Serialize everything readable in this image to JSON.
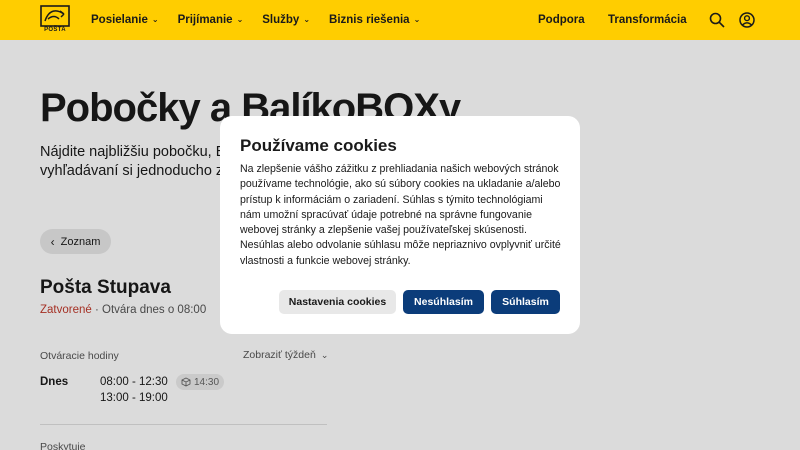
{
  "header": {
    "logo_text": "POŠTA",
    "nav": [
      {
        "label": "Posielanie"
      },
      {
        "label": "Prijímanie"
      },
      {
        "label": "Služby"
      },
      {
        "label": "Biznis riešenia"
      }
    ],
    "support_label": "Podpora",
    "transform_label": "Transformácia",
    "icons": [
      "search-icon",
      "account-icon"
    ]
  },
  "page": {
    "title": "Pobočky a BalíkoBOXy",
    "intro_line1": "Nájdite najbližšiu pobočku, B",
    "intro_line2": "vyhľadávaní si jednoducho z",
    "back_label": "Zoznam",
    "branch": {
      "name": "Pošta Stupava",
      "status": "Zatvorené",
      "opens": " · Otvára dnes o 08:00",
      "hours_label": "Otváracie hodiny",
      "week_link": "Zobraziť týždeň",
      "today_label": "Dnes",
      "time_1": "08:00 - 12:30",
      "time_2": "13:00 - 19:00",
      "box_time": "14:30",
      "provides_label": "Poskytuje"
    }
  },
  "cookie_modal": {
    "title": "Používame cookies",
    "body": "Na zlepšenie vášho zážitku z prehliadania našich webových stránok používame technológie, ako sú súbory cookies na ukladanie a/alebo prístup k informáciám o zariadení. Súhlas s týmito technológiami nám umožní spracúvať údaje potrebné na správne fungovanie webovej stránky a zlepšenie vašej používateľskej skúsenosti. Nesúhlas alebo odvolanie súhlasu môže nepriaznivo ovplyvniť určité vlastnosti a funkcie webovej stránky.",
    "settings_label": "Nastavenia cookies",
    "reject_label": "Nesúhlasím",
    "accept_label": "Súhlasím"
  },
  "colors": {
    "brand_yellow": "#ffcd00",
    "primary_blue": "#0b3c7a",
    "status_closed": "#c0392b"
  }
}
